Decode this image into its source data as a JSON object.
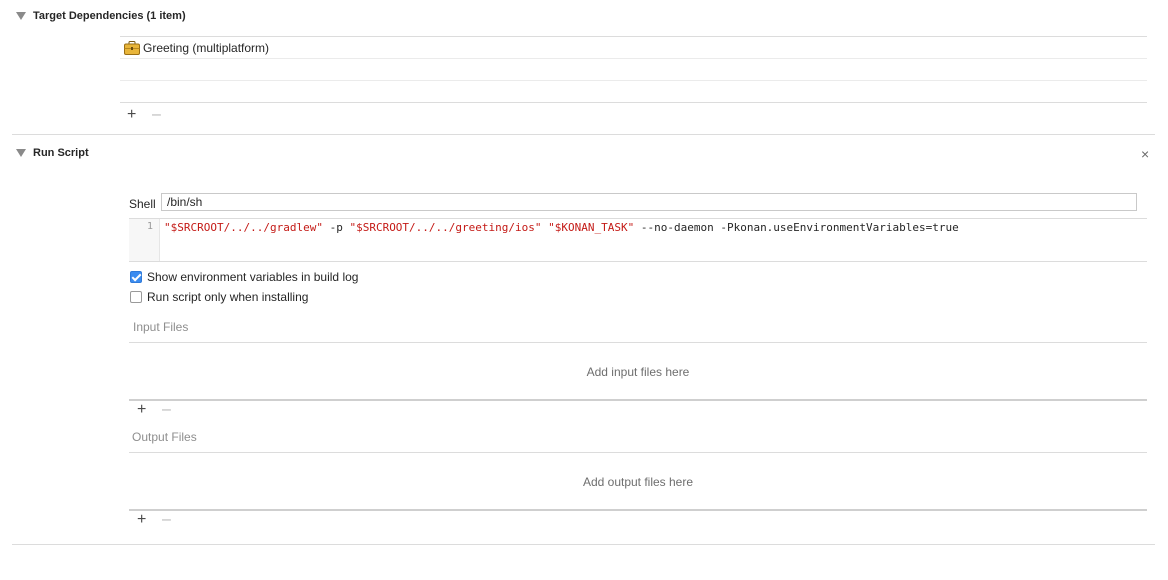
{
  "target_dependencies": {
    "title": "Target Dependencies (1 item)",
    "items": [
      {
        "label": "Greeting (multiplatform)",
        "icon": "briefcase-icon"
      }
    ]
  },
  "run_script": {
    "title": "Run Script",
    "shell_label": "Shell",
    "shell_value": "/bin/sh",
    "line_number": "1",
    "script_tokens": [
      "\"$SRCROOT/../../gradlew\"",
      " -p ",
      "\"$SRCROOT/../../greeting/ios\"",
      " ",
      "\"$KONAN_TASK\"",
      " --no-daemon -Pkonan.useEnvironmentVariables=true"
    ],
    "show_env_label": "Show environment variables in build log",
    "show_env_checked": true,
    "run_only_label": "Run script only when installing",
    "run_only_checked": false,
    "input_files_label": "Input Files",
    "input_files_placeholder": "Add input files here",
    "output_files_label": "Output Files",
    "output_files_placeholder": "Add output files here"
  },
  "colors": {
    "string_red": "#c41a16",
    "checkbox_blue": "#3b8cf0"
  }
}
